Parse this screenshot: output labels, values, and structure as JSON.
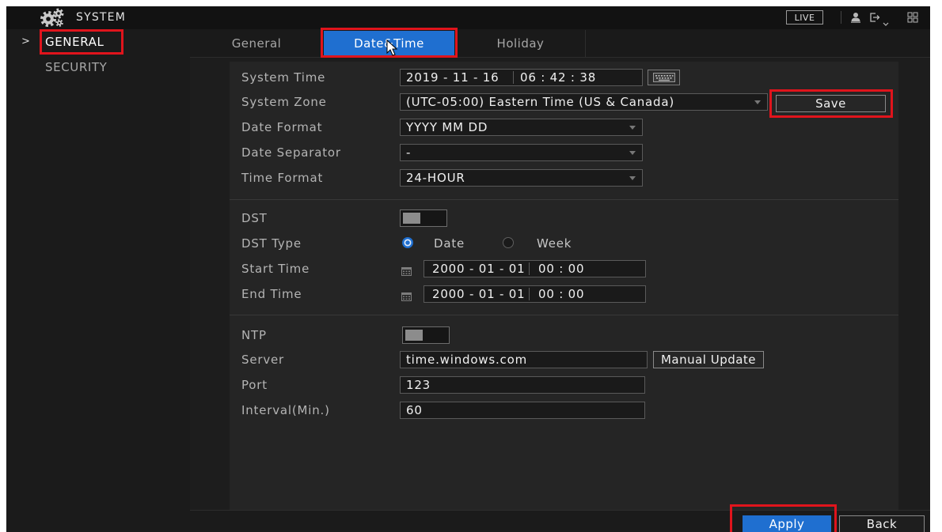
{
  "window": {
    "title": "SYSTEM"
  },
  "header": {
    "live_label": "LIVE"
  },
  "sidebar": {
    "items": [
      {
        "label": "GENERAL",
        "marker": ">",
        "active": true
      },
      {
        "label": "SECURITY",
        "active": false
      }
    ]
  },
  "tabs": [
    {
      "label": "General",
      "active": false
    },
    {
      "label": "Date&Time",
      "active": true
    },
    {
      "label": "Holiday",
      "active": false
    }
  ],
  "form": {
    "system_time": {
      "label": "System Time",
      "date": "2019 - 11 - 16",
      "time": "06 : 42 : 38"
    },
    "system_zone": {
      "label": "System Zone",
      "value": "(UTC-05:00) Eastern Time (US & Canada)"
    },
    "save_label": "Save",
    "date_format": {
      "label": "Date Format",
      "value": "YYYY MM DD"
    },
    "date_separator": {
      "label": "Date Separator",
      "value": "-"
    },
    "time_format": {
      "label": "Time Format",
      "value": "24-HOUR"
    },
    "dst": {
      "label": "DST",
      "enabled": false
    },
    "dst_type": {
      "label": "DST Type",
      "options": [
        {
          "label": "Date",
          "selected": true
        },
        {
          "label": "Week",
          "selected": false
        }
      ]
    },
    "start_time": {
      "label": "Start Time",
      "date": "2000 - 01 - 01",
      "time": "00 : 00"
    },
    "end_time": {
      "label": "End Time",
      "date": "2000 - 01 - 01",
      "time": "00 : 00"
    },
    "ntp": {
      "label": "NTP",
      "enabled": false
    },
    "server": {
      "label": "Server",
      "value": "time.windows.com"
    },
    "manual_update_label": "Manual Update",
    "port": {
      "label": "Port",
      "value": "123"
    },
    "interval": {
      "label": "Interval(Min.)",
      "value": "60"
    }
  },
  "footer": {
    "apply_label": "Apply",
    "back_label": "Back"
  },
  "icons": {
    "system": "gear-icon",
    "user": "user-icon",
    "logout": "logout-icon",
    "layout": "grid-icon",
    "keyboard": "keyboard-icon",
    "calendar": "calendar-icon",
    "dropdown": "chevron-down-icon",
    "cursor": "mouse-cursor-icon"
  },
  "colors": {
    "accent": "#1f6fd0",
    "highlight": "#e0141c"
  }
}
